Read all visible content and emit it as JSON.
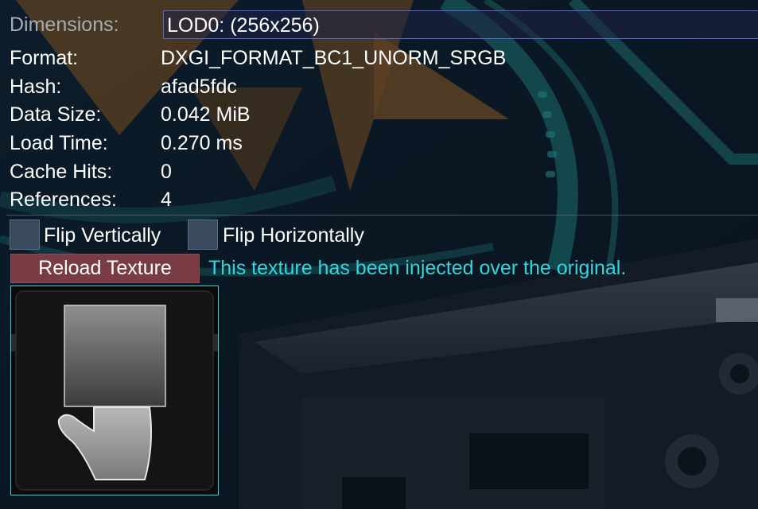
{
  "properties": {
    "dimensions_label": "Dimensions:",
    "dimensions_value": "LOD0: (256x256)",
    "rows": [
      {
        "label": "Format:",
        "value": "DXGI_FORMAT_BC1_UNORM_SRGB"
      },
      {
        "label": "Hash:",
        "value": "afad5fdc"
      },
      {
        "label": "Data Size:",
        "value": "0.042 MiB"
      },
      {
        "label": "Load Time:",
        "value": "0.270 ms"
      },
      {
        "label": "Cache Hits:",
        "value": "0"
      },
      {
        "label": "References:",
        "value": "4"
      }
    ]
  },
  "options": {
    "flip_vertically": {
      "label": "Flip Vertically",
      "checked": false
    },
    "flip_horizontally": {
      "label": "Flip Horizontally",
      "checked": false
    }
  },
  "actions": {
    "reload_label": "Reload Texture",
    "injected_note": "This texture has been injected over the original."
  },
  "colors": {
    "accent_cyan": "#31d7dd",
    "combo_border": "#5b64d1",
    "button_bg": "#7a3c44",
    "background_teal": "#1a6f70",
    "background_orange": "#8a5a2a"
  }
}
